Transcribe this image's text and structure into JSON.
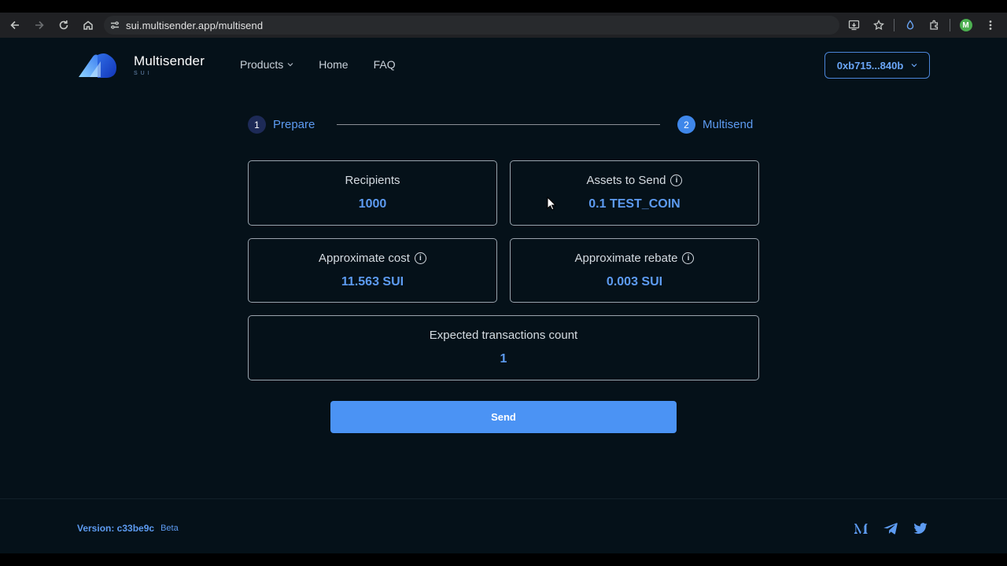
{
  "browser": {
    "url": "sui.multisender.app/multisend",
    "profile_initial": "M"
  },
  "brand": {
    "name": "Multisender",
    "sub": "SUI"
  },
  "nav": {
    "items": [
      "Products",
      "Home",
      "FAQ"
    ]
  },
  "wallet": {
    "address": "0xb715...840b"
  },
  "stepper": {
    "steps": [
      {
        "num": "1",
        "label": "Prepare"
      },
      {
        "num": "2",
        "label": "Multisend"
      }
    ]
  },
  "cards": {
    "recipients": {
      "title": "Recipients",
      "value": "1000"
    },
    "assets": {
      "title": "Assets to Send",
      "value": "0.1 TEST_COIN"
    },
    "cost": {
      "title": "Approximate cost",
      "value": "11.563 SUI"
    },
    "rebate": {
      "title": "Approximate rebate",
      "value": "0.003 SUI"
    },
    "tx_count": {
      "title": "Expected transactions count",
      "value": "1"
    }
  },
  "actions": {
    "send_label": "Send"
  },
  "footer": {
    "version": "Version: c33be9c",
    "badge": "Beta"
  },
  "colors": {
    "background": "#051119",
    "accent": "#4b93f4",
    "value_text": "#5d9bf1"
  }
}
